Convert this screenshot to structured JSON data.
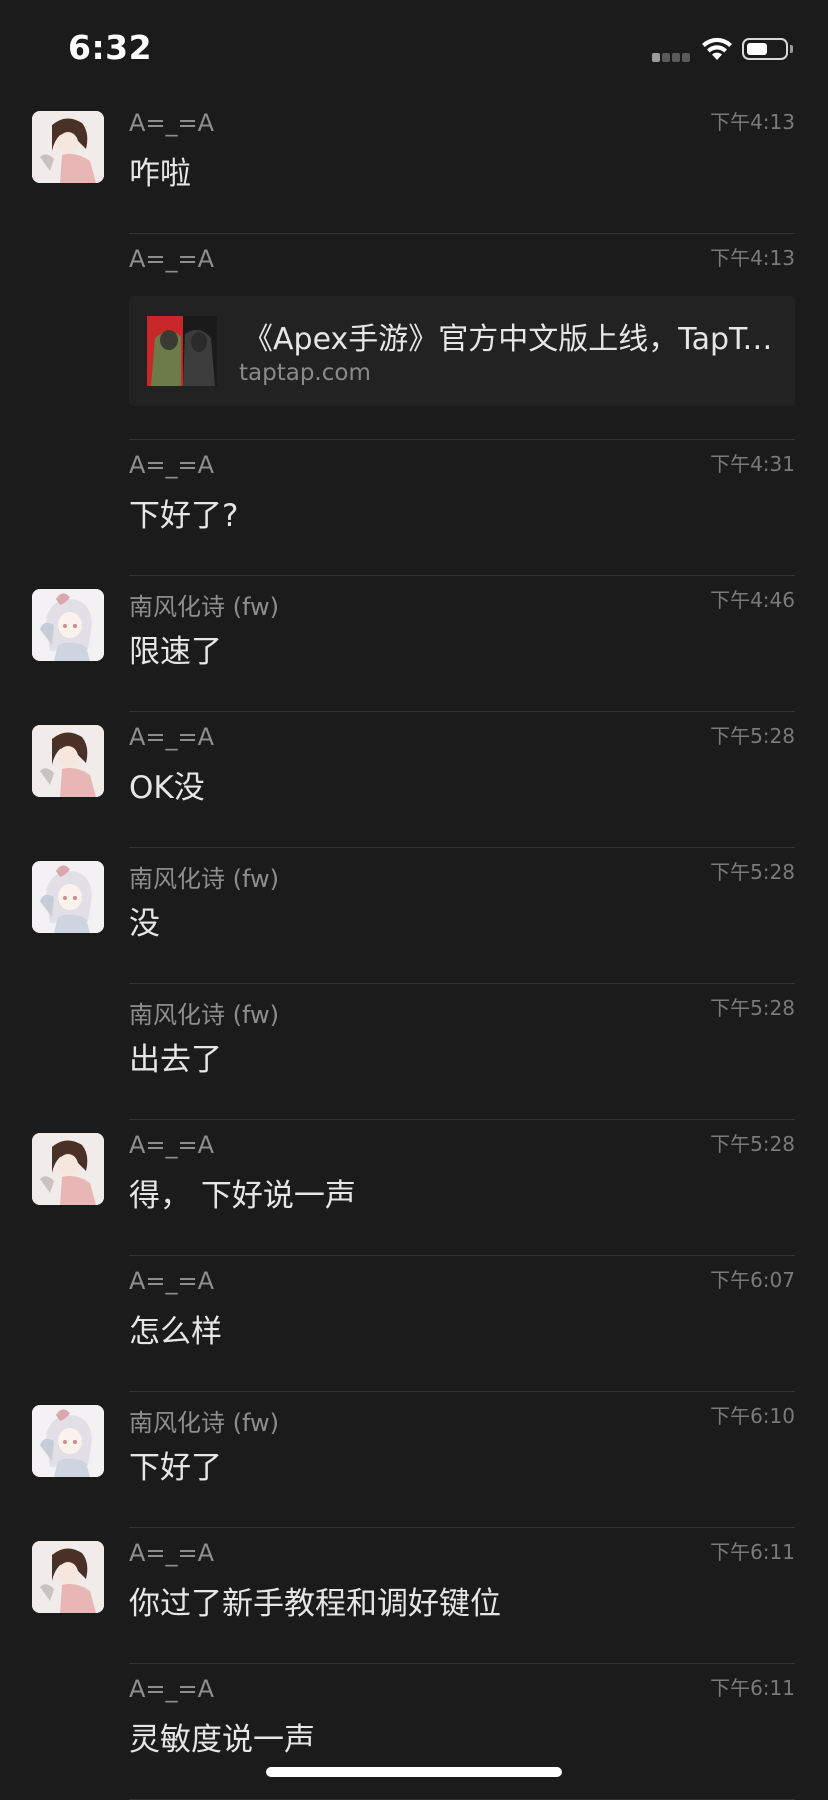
{
  "status_bar": {
    "time": "6:32",
    "battery_level": 0.55,
    "icons": [
      "cellular-signal-icon",
      "wifi-icon",
      "battery-icon"
    ]
  },
  "link_card": {
    "title": "《Apex手游》官方中文版上线，TapTap",
    "domain": "taptap.com"
  },
  "messages": [
    {
      "sender": "A=_=A",
      "time": "下午4:13",
      "text": "咋啦",
      "avatar": "avatar-a"
    },
    {
      "sender": "A=_=A",
      "time": "下午4:13",
      "type": "link"
    },
    {
      "sender": "A=_=A",
      "time": "下午4:31",
      "text": "下好了?"
    },
    {
      "sender": "南风化诗 (fw)",
      "time": "下午4:46",
      "text": "限速了",
      "avatar": "avatar-nanfeng"
    },
    {
      "sender": "A=_=A",
      "time": "下午5:28",
      "text": "OK没",
      "avatar": "avatar-a"
    },
    {
      "sender": "南风化诗 (fw)",
      "time": "下午5:28",
      "text": "没",
      "avatar": "avatar-nanfeng"
    },
    {
      "sender": "南风化诗 (fw)",
      "time": "下午5:28",
      "text": "出去了"
    },
    {
      "sender": "A=_=A",
      "time": "下午5:28",
      "text": "得， 下好说一声",
      "avatar": "avatar-a"
    },
    {
      "sender": "A=_=A",
      "time": "下午6:07",
      "text": "怎么样"
    },
    {
      "sender": "南风化诗 (fw)",
      "time": "下午6:10",
      "text": "下好了",
      "avatar": "avatar-nanfeng"
    },
    {
      "sender": "A=_=A",
      "time": "下午6:11",
      "text": "你过了新手教程和调好键位",
      "avatar": "avatar-a"
    },
    {
      "sender": "A=_=A",
      "time": "下午6:11",
      "text": "灵敏度说一声"
    }
  ],
  "colors": {
    "background": "#1b1b1b",
    "text": "#e6e6e6",
    "secondary_text": "#8e8e8e",
    "divider": "#333333",
    "card": "#222222"
  }
}
